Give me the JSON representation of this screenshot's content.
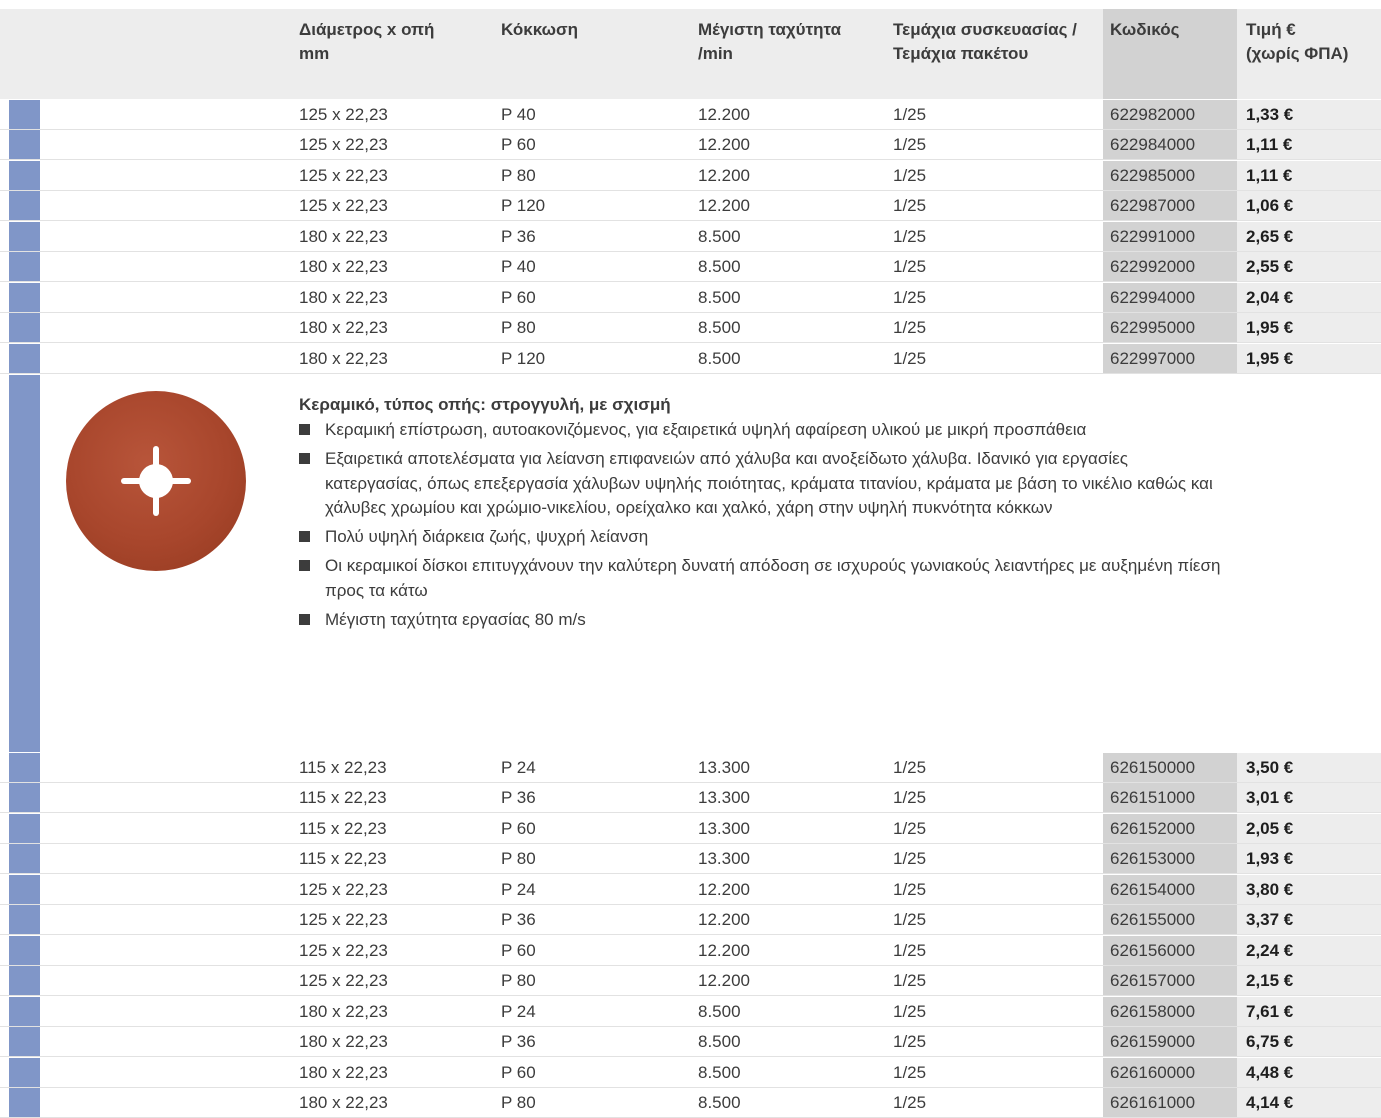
{
  "header": {
    "col_diameter": [
      "Διάμετρος x οπή",
      "mm"
    ],
    "col_grit": [
      "Κόκκωση"
    ],
    "col_speed": [
      "Μέγιστη ταχύτητα",
      "/min"
    ],
    "col_pack": [
      "Τεμάχια συσκευασίας /",
      "Τεμάχια πακέτου"
    ],
    "col_code": [
      "Κωδικός"
    ],
    "col_price": [
      "Τιμή €",
      "(χωρίς ΦΠΑ)"
    ]
  },
  "table1": [
    [
      "125 x 22,23",
      "P 40",
      "12.200",
      "1/25",
      "622982000",
      "1,33 €"
    ],
    [
      "125 x 22,23",
      "P 60",
      "12.200",
      "1/25",
      "622984000",
      "1,11 €"
    ],
    [
      "125 x 22,23",
      "P 80",
      "12.200",
      "1/25",
      "622985000",
      "1,11 €"
    ],
    [
      "125 x 22,23",
      "P 120",
      "12.200",
      "1/25",
      "622987000",
      "1,06 €"
    ],
    [
      "180 x 22,23",
      "P 36",
      "8.500",
      "1/25",
      "622991000",
      "2,65 €"
    ],
    [
      "180 x 22,23",
      "P 40",
      "8.500",
      "1/25",
      "622992000",
      "2,55 €"
    ],
    [
      "180 x 22,23",
      "P 60",
      "8.500",
      "1/25",
      "622994000",
      "2,04 €"
    ],
    [
      "180 x 22,23",
      "P 80",
      "8.500",
      "1/25",
      "622995000",
      "1,95 €"
    ],
    [
      "180 x 22,23",
      "P 120",
      "8.500",
      "1/25",
      "622997000",
      "1,95 €"
    ]
  ],
  "product": {
    "title": "Κεραμικό, τύπος οπής: στρογγυλή, με σχισμή",
    "bullets": [
      "Κεραμική επίστρωση, αυτοακονιζόμενος, για εξαιρετικά υψηλή αφαίρεση υλικού με μικρή προσπάθεια",
      "Εξαιρετικά αποτελέσματα για λείανση επιφανειών από χάλυβα και ανοξείδωτο χάλυβα. Ιδανικό για εργασίες κατεργασίας, όπως επεξεργασία χάλυβων υψηλής ποιότητας, κράματα τιτανίου, κράματα με βάση το νικέλιο καθώς και χάλυβες χρωμίου και χρώμιο-νικελίου, ορείχαλκο και χαλκό, χάρη στην υψηλή πυκνότητα κόκκων",
      "Πολύ υψηλή διάρκεια ζωής, ψυχρή λείανση",
      "Οι κεραμικοί δίσκοι επιτυγχάνουν την καλύτερη δυνατή απόδοση σε ισχυρούς γωνιακούς λειαντήρες με αυξημένη πίεση προς τα κάτω",
      "Μέγιστη ταχύτητα εργασίας 80 m/s"
    ]
  },
  "table2": [
    [
      "115 x 22,23",
      "P 24",
      "13.300",
      "1/25",
      "626150000",
      "3,50 €"
    ],
    [
      "115 x 22,23",
      "P 36",
      "13.300",
      "1/25",
      "626151000",
      "3,01 €"
    ],
    [
      "115 x 22,23",
      "P 60",
      "13.300",
      "1/25",
      "626152000",
      "2,05 €"
    ],
    [
      "115 x 22,23",
      "P 80",
      "13.300",
      "1/25",
      "626153000",
      "1,93 €"
    ],
    [
      "125 x 22,23",
      "P 24",
      "12.200",
      "1/25",
      "626154000",
      "3,80 €"
    ],
    [
      "125 x 22,23",
      "P 36",
      "12.200",
      "1/25",
      "626155000",
      "3,37 €"
    ],
    [
      "125 x 22,23",
      "P 60",
      "12.200",
      "1/25",
      "626156000",
      "2,24 €"
    ],
    [
      "125 x 22,23",
      "P 80",
      "12.200",
      "1/25",
      "626157000",
      "2,15 €"
    ],
    [
      "180 x 22,23",
      "P 24",
      "8.500",
      "1/25",
      "626158000",
      "7,61 €"
    ],
    [
      "180 x 22,23",
      "P 36",
      "8.500",
      "1/25",
      "626159000",
      "6,75 €"
    ],
    [
      "180 x 22,23",
      "P 60",
      "8.500",
      "1/25",
      "626160000",
      "4,48 €"
    ],
    [
      "180 x 22,23",
      "P 80",
      "8.500",
      "1/25",
      "626161000",
      "4,14 €"
    ]
  ],
  "colors": {
    "marker": "#8096c8",
    "header_bg": "#ededed",
    "code_bg": "#d2d2d2",
    "disc": "#a8462c"
  }
}
